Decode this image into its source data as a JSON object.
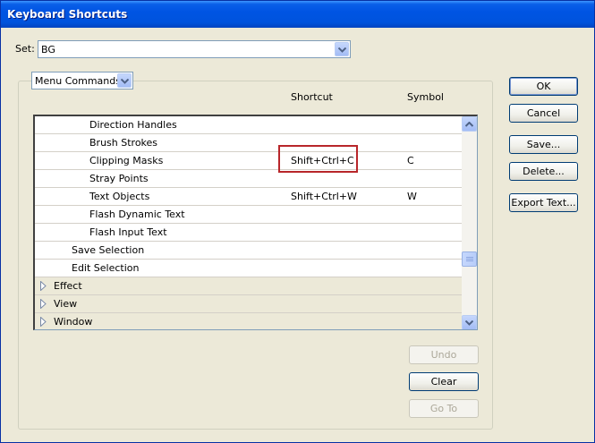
{
  "window": {
    "title": "Keyboard Shortcuts"
  },
  "set": {
    "label": "Set:",
    "value": "BG"
  },
  "category": {
    "value": "Menu Commands"
  },
  "columns": {
    "shortcut": "Shortcut",
    "symbol": "Symbol"
  },
  "rows": [
    {
      "name": "Direction Handles",
      "shortcut": "",
      "symbol": ""
    },
    {
      "name": "Brush Strokes",
      "shortcut": "",
      "symbol": ""
    },
    {
      "name": "Clipping Masks",
      "shortcut": "Shift+Ctrl+C",
      "symbol": "C"
    },
    {
      "name": "Stray Points",
      "shortcut": "",
      "symbol": ""
    },
    {
      "name": "Text Objects",
      "shortcut": "Shift+Ctrl+W",
      "symbol": "W"
    },
    {
      "name": "Flash Dynamic Text",
      "shortcut": "",
      "symbol": ""
    },
    {
      "name": "Flash Input Text",
      "shortcut": "",
      "symbol": ""
    },
    {
      "name": "Save Selection",
      "shortcut": "",
      "symbol": ""
    },
    {
      "name": "Edit Selection",
      "shortcut": "",
      "symbol": ""
    },
    {
      "name": "Effect",
      "shortcut": "",
      "symbol": ""
    },
    {
      "name": "View",
      "shortcut": "",
      "symbol": ""
    },
    {
      "name": "Window",
      "shortcut": "",
      "symbol": ""
    }
  ],
  "buttons": {
    "ok": "OK",
    "cancel": "Cancel",
    "save": "Save...",
    "delete": "Delete...",
    "export": "Export Text...",
    "undo": "Undo",
    "clear": "Clear",
    "goto": "Go To"
  },
  "icons": {
    "dropdown": "chevron-down-icon",
    "expand": "triangle-right-icon",
    "scroll_up": "arrow-up-icon",
    "scroll_down": "arrow-down-icon"
  },
  "colors": {
    "title_bar": "#0054e3",
    "highlight": "#b8262a",
    "dialog_bg": "#ece9d8"
  }
}
